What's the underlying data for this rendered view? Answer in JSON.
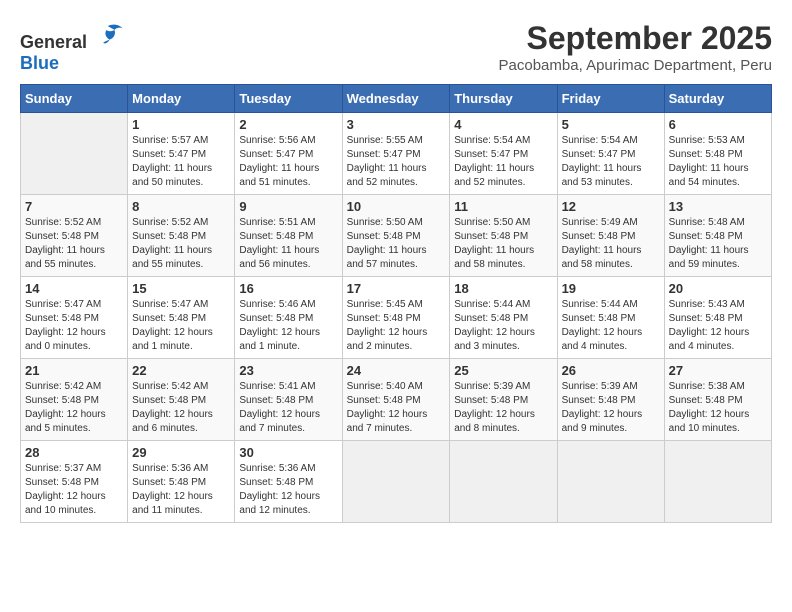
{
  "header": {
    "logo_general": "General",
    "logo_blue": "Blue",
    "month_title": "September 2025",
    "subtitle": "Pacobamba, Apurimac Department, Peru"
  },
  "days_of_week": [
    "Sunday",
    "Monday",
    "Tuesday",
    "Wednesday",
    "Thursday",
    "Friday",
    "Saturday"
  ],
  "weeks": [
    [
      {
        "day": "",
        "info": ""
      },
      {
        "day": "1",
        "info": "Sunrise: 5:57 AM\nSunset: 5:47 PM\nDaylight: 11 hours\nand 50 minutes."
      },
      {
        "day": "2",
        "info": "Sunrise: 5:56 AM\nSunset: 5:47 PM\nDaylight: 11 hours\nand 51 minutes."
      },
      {
        "day": "3",
        "info": "Sunrise: 5:55 AM\nSunset: 5:47 PM\nDaylight: 11 hours\nand 52 minutes."
      },
      {
        "day": "4",
        "info": "Sunrise: 5:54 AM\nSunset: 5:47 PM\nDaylight: 11 hours\nand 52 minutes."
      },
      {
        "day": "5",
        "info": "Sunrise: 5:54 AM\nSunset: 5:47 PM\nDaylight: 11 hours\nand 53 minutes."
      },
      {
        "day": "6",
        "info": "Sunrise: 5:53 AM\nSunset: 5:48 PM\nDaylight: 11 hours\nand 54 minutes."
      }
    ],
    [
      {
        "day": "7",
        "info": "Sunrise: 5:52 AM\nSunset: 5:48 PM\nDaylight: 11 hours\nand 55 minutes."
      },
      {
        "day": "8",
        "info": "Sunrise: 5:52 AM\nSunset: 5:48 PM\nDaylight: 11 hours\nand 55 minutes."
      },
      {
        "day": "9",
        "info": "Sunrise: 5:51 AM\nSunset: 5:48 PM\nDaylight: 11 hours\nand 56 minutes."
      },
      {
        "day": "10",
        "info": "Sunrise: 5:50 AM\nSunset: 5:48 PM\nDaylight: 11 hours\nand 57 minutes."
      },
      {
        "day": "11",
        "info": "Sunrise: 5:50 AM\nSunset: 5:48 PM\nDaylight: 11 hours\nand 58 minutes."
      },
      {
        "day": "12",
        "info": "Sunrise: 5:49 AM\nSunset: 5:48 PM\nDaylight: 11 hours\nand 58 minutes."
      },
      {
        "day": "13",
        "info": "Sunrise: 5:48 AM\nSunset: 5:48 PM\nDaylight: 11 hours\nand 59 minutes."
      }
    ],
    [
      {
        "day": "14",
        "info": "Sunrise: 5:47 AM\nSunset: 5:48 PM\nDaylight: 12 hours\nand 0 minutes."
      },
      {
        "day": "15",
        "info": "Sunrise: 5:47 AM\nSunset: 5:48 PM\nDaylight: 12 hours\nand 1 minute."
      },
      {
        "day": "16",
        "info": "Sunrise: 5:46 AM\nSunset: 5:48 PM\nDaylight: 12 hours\nand 1 minute."
      },
      {
        "day": "17",
        "info": "Sunrise: 5:45 AM\nSunset: 5:48 PM\nDaylight: 12 hours\nand 2 minutes."
      },
      {
        "day": "18",
        "info": "Sunrise: 5:44 AM\nSunset: 5:48 PM\nDaylight: 12 hours\nand 3 minutes."
      },
      {
        "day": "19",
        "info": "Sunrise: 5:44 AM\nSunset: 5:48 PM\nDaylight: 12 hours\nand 4 minutes."
      },
      {
        "day": "20",
        "info": "Sunrise: 5:43 AM\nSunset: 5:48 PM\nDaylight: 12 hours\nand 4 minutes."
      }
    ],
    [
      {
        "day": "21",
        "info": "Sunrise: 5:42 AM\nSunset: 5:48 PM\nDaylight: 12 hours\nand 5 minutes."
      },
      {
        "day": "22",
        "info": "Sunrise: 5:42 AM\nSunset: 5:48 PM\nDaylight: 12 hours\nand 6 minutes."
      },
      {
        "day": "23",
        "info": "Sunrise: 5:41 AM\nSunset: 5:48 PM\nDaylight: 12 hours\nand 7 minutes."
      },
      {
        "day": "24",
        "info": "Sunrise: 5:40 AM\nSunset: 5:48 PM\nDaylight: 12 hours\nand 7 minutes."
      },
      {
        "day": "25",
        "info": "Sunrise: 5:39 AM\nSunset: 5:48 PM\nDaylight: 12 hours\nand 8 minutes."
      },
      {
        "day": "26",
        "info": "Sunrise: 5:39 AM\nSunset: 5:48 PM\nDaylight: 12 hours\nand 9 minutes."
      },
      {
        "day": "27",
        "info": "Sunrise: 5:38 AM\nSunset: 5:48 PM\nDaylight: 12 hours\nand 10 minutes."
      }
    ],
    [
      {
        "day": "28",
        "info": "Sunrise: 5:37 AM\nSunset: 5:48 PM\nDaylight: 12 hours\nand 10 minutes."
      },
      {
        "day": "29",
        "info": "Sunrise: 5:36 AM\nSunset: 5:48 PM\nDaylight: 12 hours\nand 11 minutes."
      },
      {
        "day": "30",
        "info": "Sunrise: 5:36 AM\nSunset: 5:48 PM\nDaylight: 12 hours\nand 12 minutes."
      },
      {
        "day": "",
        "info": ""
      },
      {
        "day": "",
        "info": ""
      },
      {
        "day": "",
        "info": ""
      },
      {
        "day": "",
        "info": ""
      }
    ]
  ]
}
